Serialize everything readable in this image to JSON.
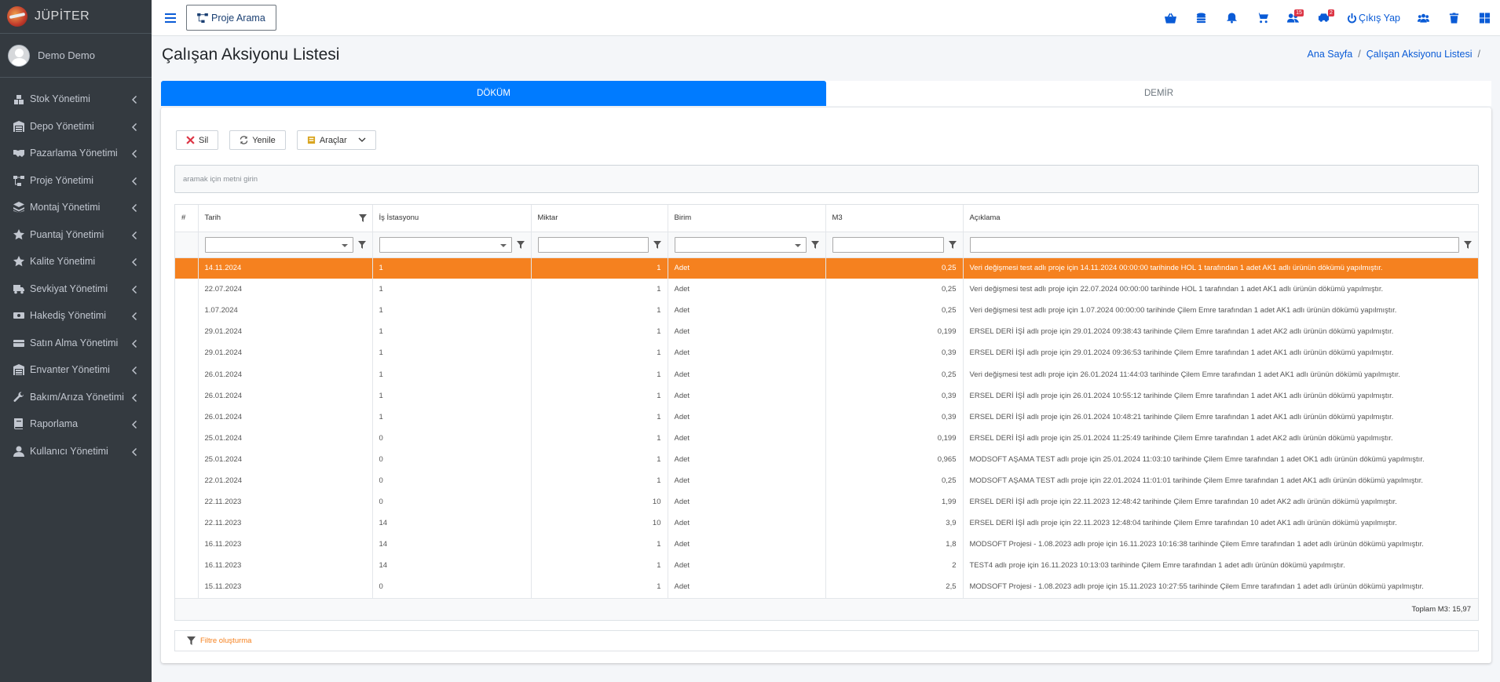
{
  "brand": {
    "name": "JÜPİTER"
  },
  "user": {
    "name": "Demo Demo"
  },
  "sidebar": {
    "items": [
      {
        "label": "Stok Yönetimi",
        "icon": "boxes-icon"
      },
      {
        "label": "Depo Yönetimi",
        "icon": "warehouse-icon"
      },
      {
        "label": "Pazarlama Yönetimi",
        "icon": "handshake-icon"
      },
      {
        "label": "Proje Yönetimi",
        "icon": "project-diagram-icon"
      },
      {
        "label": "Montaj Yönetimi",
        "icon": "layers-icon"
      },
      {
        "label": "Puantaj Yönetimi",
        "icon": "star-icon"
      },
      {
        "label": "Kalite Yönetimi",
        "icon": "star-icon"
      },
      {
        "label": "Sevkiyat Yönetimi",
        "icon": "truck-icon"
      },
      {
        "label": "Hakediş Yönetimi",
        "icon": "money-icon"
      },
      {
        "label": "Satın Alma Yönetimi",
        "icon": "cash-register-icon"
      },
      {
        "label": "Envanter Yönetimi",
        "icon": "warehouse-icon"
      },
      {
        "label": "Bakım/Arıza Yönetimi",
        "icon": "wrench-icon"
      },
      {
        "label": "Raporlama",
        "icon": "book-icon"
      },
      {
        "label": "Kullanıcı Yönetimi",
        "icon": "user-icon"
      }
    ]
  },
  "topbar": {
    "proje_arama": "Proje Arama",
    "badges": {
      "users": "15",
      "cars": "2"
    },
    "logout": "Çıkış Yap"
  },
  "page": {
    "title": "Çalışan Aksiyonu Listesi",
    "breadcrumb": [
      "Ana Sayfa",
      "Çalışan Aksiyonu Listesi",
      ""
    ]
  },
  "tabs": [
    {
      "label": "DÖKÜM",
      "active": true
    },
    {
      "label": "DEMİR",
      "active": false
    }
  ],
  "toolbar": {
    "delete": "Sil",
    "refresh": "Yenile",
    "tools": "Araçlar"
  },
  "search": {
    "placeholder": "aramak için metni girin"
  },
  "grid": {
    "columns": [
      "#",
      "Tarih",
      "İş İstasyonu",
      "Miktar",
      "Birim",
      "M3",
      "Açıklama"
    ],
    "rows": [
      [
        "14.11.2024",
        "1",
        "1",
        "Adet",
        "0,25",
        "Veri değişmesi test adlı proje için 14.11.2024 00:00:00 tarihinde HOL 1 tarafından 1 adet AK1 adlı ürünün dökümü yapılmıştır."
      ],
      [
        "22.07.2024",
        "1",
        "1",
        "Adet",
        "0,25",
        "Veri değişmesi test adlı proje için 22.07.2024 00:00:00 tarihinde HOL 1 tarafından 1 adet AK1 adlı ürünün dökümü yapılmıştır."
      ],
      [
        "1.07.2024",
        "1",
        "1",
        "Adet",
        "0,25",
        "Veri değişmesi test adlı proje için 1.07.2024 00:00:00 tarihinde Çilem Emre tarafından 1 adet AK1 adlı ürünün dökümü yapılmıştır."
      ],
      [
        "29.01.2024",
        "1",
        "1",
        "Adet",
        "0,199",
        "ERSEL DERİ İŞİ adlı proje için 29.01.2024 09:38:43 tarihinde Çilem Emre tarafından 1 adet AK2 adlı ürünün dökümü yapılmıştır."
      ],
      [
        "29.01.2024",
        "1",
        "1",
        "Adet",
        "0,39",
        "ERSEL DERİ İŞİ adlı proje için 29.01.2024 09:36:53 tarihinde Çilem Emre tarafından 1 adet AK1 adlı ürünün dökümü yapılmıştır."
      ],
      [
        "26.01.2024",
        "1",
        "1",
        "Adet",
        "0,25",
        "Veri değişmesi test adlı proje için 26.01.2024 11:44:03 tarihinde Çilem Emre tarafından 1 adet AK1 adlı ürünün dökümü yapılmıştır."
      ],
      [
        "26.01.2024",
        "1",
        "1",
        "Adet",
        "0,39",
        "ERSEL DERİ İŞİ adlı proje için 26.01.2024 10:55:12 tarihinde Çilem Emre tarafından 1 adet AK1 adlı ürünün dökümü yapılmıştır."
      ],
      [
        "26.01.2024",
        "1",
        "1",
        "Adet",
        "0,39",
        "ERSEL DERİ İŞİ adlı proje için 26.01.2024 10:48:21 tarihinde Çilem Emre tarafından 1 adet AK1 adlı ürünün dökümü yapılmıştır."
      ],
      [
        "25.01.2024",
        "0",
        "1",
        "Adet",
        "0,199",
        "ERSEL DERİ İŞİ adlı proje için 25.01.2024 11:25:49 tarihinde Çilem Emre tarafından 1 adet AK2 adlı ürünün dökümü yapılmıştır."
      ],
      [
        "25.01.2024",
        "0",
        "1",
        "Adet",
        "0,965",
        "MODSOFT AŞAMA TEST adlı proje için 25.01.2024 11:03:10 tarihinde Çilem Emre tarafından 1 adet OK1 adlı ürünün dökümü yapılmıştır."
      ],
      [
        "22.01.2024",
        "0",
        "1",
        "Adet",
        "0,25",
        "MODSOFT AŞAMA TEST adlı proje için 22.01.2024 11:01:01 tarihinde Çilem Emre tarafından 1 adet AK1 adlı ürünün dökümü yapılmıştır."
      ],
      [
        "22.11.2023",
        "0",
        "10",
        "Adet",
        "1,99",
        "ERSEL DERİ İŞİ adlı proje için 22.11.2023 12:48:42 tarihinde Çilem Emre tarafından 10 adet AK2 adlı ürünün dökümü yapılmıştır."
      ],
      [
        "22.11.2023",
        "14",
        "10",
        "Adet",
        "3,9",
        "ERSEL DERİ İŞİ adlı proje için 22.11.2023 12:48:04 tarihinde Çilem Emre tarafından 10 adet AK1 adlı ürünün dökümü yapılmıştır."
      ],
      [
        "16.11.2023",
        "14",
        "1",
        "Adet",
        "1,8",
        "MODSOFT Projesi - 1.08.2023 adlı proje için 16.11.2023 10:16:38 tarihinde Çilem Emre tarafından 1 adet adlı ürünün dökümü yapılmıştır."
      ],
      [
        "16.11.2023",
        "14",
        "1",
        "Adet",
        "2",
        "TEST4 adlı proje için 16.11.2023 10:13:03 tarihinde Çilem Emre tarafından 1 adet adlı ürünün dökümü yapılmıştır."
      ],
      [
        "15.11.2023",
        "0",
        "1",
        "Adet",
        "2,5",
        "MODSOFT Projesi - 1.08.2023 adlı proje için 15.11.2023 10:27:55 tarihinde Çilem Emre tarafından 1 adet adlı ürünün dökümü yapılmıştır."
      ]
    ],
    "selected_row": 0,
    "total": "Toplam M3: 15,97"
  },
  "filter_builder": {
    "label": "Filtre oluşturma"
  },
  "colors": {
    "accent": "#007bff",
    "selected_row": "#f5811f",
    "sidebar": "#343a40"
  }
}
